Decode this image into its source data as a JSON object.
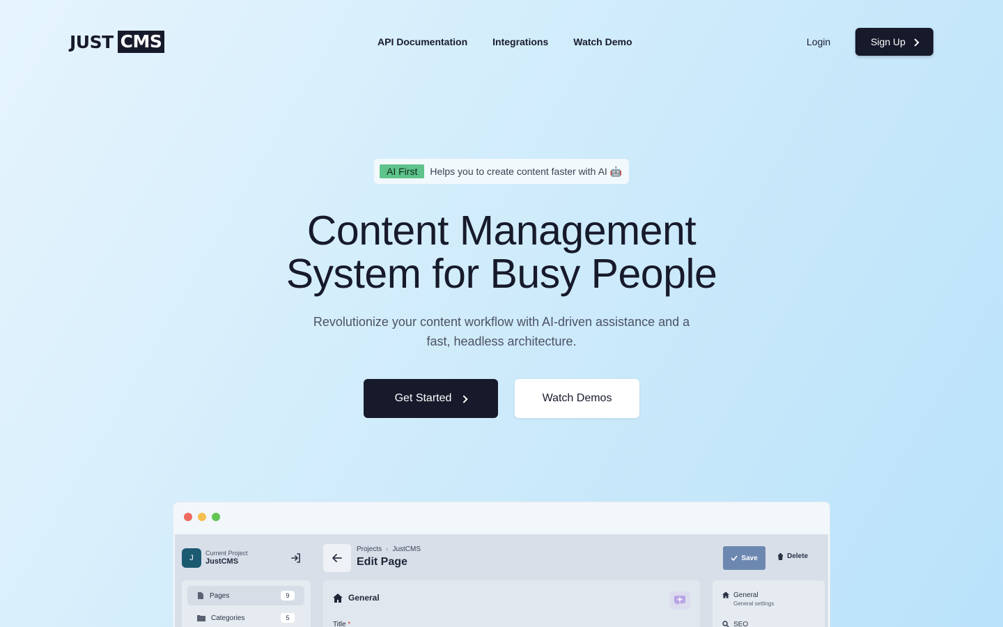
{
  "brand": {
    "logo_left": "JUST",
    "logo_right": "CMS"
  },
  "nav": {
    "items": [
      "API Documentation",
      "Integrations",
      "Watch Demo"
    ],
    "login": "Login",
    "signup": "Sign Up"
  },
  "announcement": {
    "badge": "AI First",
    "text": "Helps you to create content faster with AI 🤖"
  },
  "hero": {
    "title_line1": "Content Management",
    "title_line2": "System for Busy People",
    "subtitle": "Revolutionize your content workflow with AI-driven assistance and a fast, headless architecture.",
    "primary_cta": "Get Started",
    "secondary_cta": "Watch Demos"
  },
  "preview": {
    "window_dots": [
      "#ed6a5e",
      "#f4bf4f",
      "#61c554"
    ],
    "project": {
      "avatar": "J",
      "label": "Current Project",
      "name": "JustCMS"
    },
    "sidebar": [
      {
        "label": "Pages",
        "count": "9",
        "icon": "page-icon"
      },
      {
        "label": "Categories",
        "count": "5",
        "icon": "folder-icon"
      }
    ],
    "breadcrumb": [
      "Projects",
      "JustCMS"
    ],
    "page_title": "Edit Page",
    "save": "Save",
    "delete": "Delete",
    "section": "General",
    "field_label": "Title",
    "required_mark": "*",
    "right_panel": [
      {
        "title": "General",
        "subtitle": "General settings",
        "icon": "home-icon"
      },
      {
        "title": "SEO",
        "subtitle": "",
        "icon": "search-icon"
      }
    ]
  }
}
